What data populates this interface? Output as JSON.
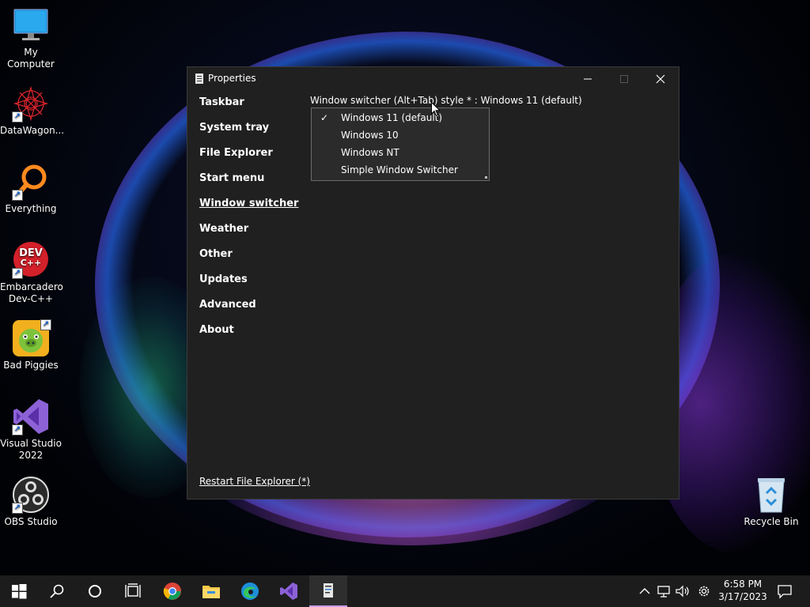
{
  "desktop": {
    "icons": [
      {
        "label": "My Computer"
      },
      {
        "label": "DataWagon..."
      },
      {
        "label": "Everything"
      },
      {
        "label_line1": "Embarcadero",
        "label_line2": "Dev-C++"
      },
      {
        "label": "Bad Piggies"
      },
      {
        "label_line1": "Visual Studio",
        "label_line2": "2022"
      },
      {
        "label": "OBS Studio"
      },
      {
        "label": "Recycle Bin"
      }
    ],
    "devcpp_badge": "DEV",
    "devcpp_badge2": "C++"
  },
  "window": {
    "title": "Properties",
    "nav": [
      {
        "label": "Taskbar"
      },
      {
        "label": "System tray"
      },
      {
        "label": "File Explorer"
      },
      {
        "label": "Start menu"
      },
      {
        "label": "Window switcher",
        "active": true
      },
      {
        "label": "Weather"
      },
      {
        "label": "Other"
      },
      {
        "label": "Updates"
      },
      {
        "label": "Advanced"
      },
      {
        "label": "About"
      }
    ],
    "setting_label": "Window switcher (Alt+Tab) style * : Windows 11 (default)",
    "dropdown": {
      "options": [
        "Windows 11 (default)",
        "Windows 10",
        "Windows NT",
        "Simple Window Switcher"
      ],
      "selected": "Windows 11 (default)",
      "check": "✓"
    },
    "restart_link": "Restart File Explorer (*)"
  },
  "taskbar": {
    "items": [
      "start-button",
      "search-icon",
      "cortana-icon",
      "task-view-icon",
      "chrome-icon",
      "file-explorer-icon",
      "edge-icon",
      "visual-studio-icon",
      "properties-app-icon"
    ],
    "clock_time": "6:58 PM",
    "clock_date": "3/17/2023"
  },
  "colors": {
    "window_bg": "#202020",
    "dropdown_bg": "#2b2b2b",
    "taskbar_bg": "#1c1c1c",
    "active_indicator": "#c89be8"
  }
}
